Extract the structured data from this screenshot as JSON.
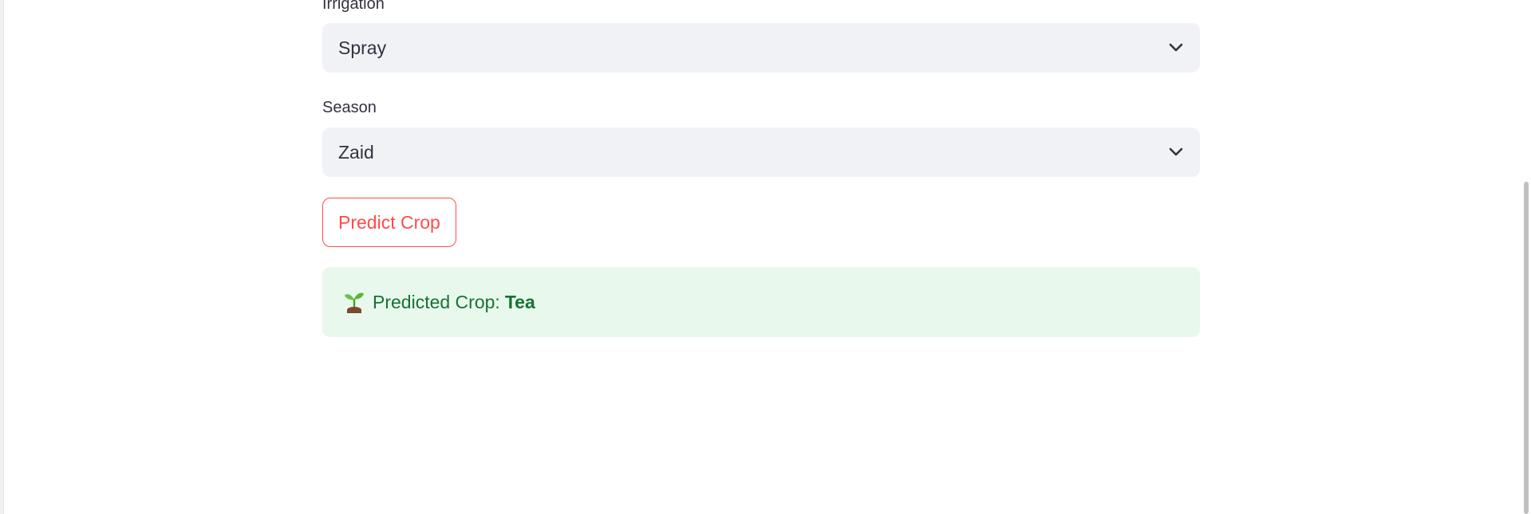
{
  "form": {
    "irrigation": {
      "label": "Irrigation",
      "value": "Spray"
    },
    "season": {
      "label": "Season",
      "value": "Zaid"
    },
    "predict_button_label": "Predict Crop"
  },
  "result": {
    "icon": "seedling-icon",
    "prefix": "Predicted Crop:",
    "value": "Tea"
  },
  "colors": {
    "accent": "#ff4b4b",
    "success_text": "#177233",
    "success_bg": "#e8f8ed",
    "select_bg": "#f0f2f6"
  }
}
